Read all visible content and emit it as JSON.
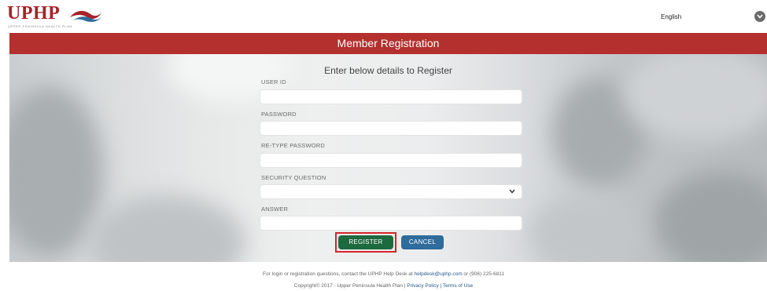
{
  "header": {
    "logo_text": "UPHP",
    "logo_subtitle": "UPPER PENINSULA HEALTH PLAN",
    "language_selected": "English"
  },
  "banner": {
    "title": "Member Registration"
  },
  "form": {
    "heading": "Enter below details to Register",
    "user_id_label": "USER ID",
    "user_id_value": "",
    "password_label": "PASSWORD",
    "password_value": "",
    "retype_password_label": "RE-TYPE PASSWORD",
    "retype_password_value": "",
    "security_question_label": "SECURITY QUESTION",
    "security_question_value": "",
    "answer_label": "ANSWER",
    "answer_value": "",
    "register_label": "REGISTER",
    "cancel_label": "CANCEL"
  },
  "footer": {
    "help_prefix": "For login or registration questions, contact the UPHP Help Desk at ",
    "help_email": "helpdesk@uphp.com",
    "help_suffix": " or (906) 225-6811",
    "copyright": "Copyright© 2017 - Upper Peninsula Health Plan | ",
    "privacy_label": "Privacy Policy",
    "separator": " | ",
    "terms_label": "Terms of Use"
  },
  "colors": {
    "brand_red": "#b3302f",
    "register_green": "#1e6a3f",
    "cancel_blue": "#2f6b9b",
    "highlight_outline": "#d6242b"
  }
}
